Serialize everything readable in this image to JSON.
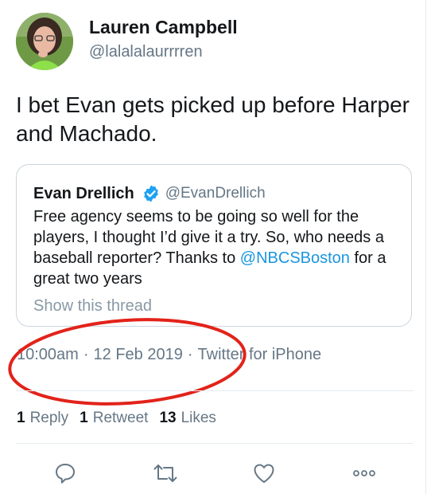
{
  "author": {
    "name": "Lauren Campbell",
    "handle": "@lalalalaurrrren"
  },
  "tweet": {
    "text": "I bet Evan gets picked up before Harper and Machado."
  },
  "quoted": {
    "name": "Evan Drellich",
    "handle": "@EvanDrellich",
    "text_before": "Free agency seems to be going so well for the players, I thought I’d give it a try. So, who needs a baseball reporter? Thanks to ",
    "mention": "@NBCSBoston",
    "text_after": " for a great two years",
    "show_thread": "Show this thread"
  },
  "meta": {
    "time": "10:00am",
    "date": "12 Feb 2019",
    "source": "Twitter for iPhone",
    "separator": "·"
  },
  "stats": {
    "replies_count": "1",
    "replies_label": "Reply",
    "retweets_count": "1",
    "retweets_label": "Retweet",
    "likes_count": "13",
    "likes_label": "Likes"
  },
  "colors": {
    "link": "#1b95e0",
    "verified": "#1da1f2",
    "annotation": "#e2231a",
    "secondary_text": "#657786"
  },
  "icons": {
    "reply": "speech-bubble-icon",
    "retweet": "retweet-arrows-icon",
    "like": "heart-icon",
    "more": "more-dots-icon"
  }
}
